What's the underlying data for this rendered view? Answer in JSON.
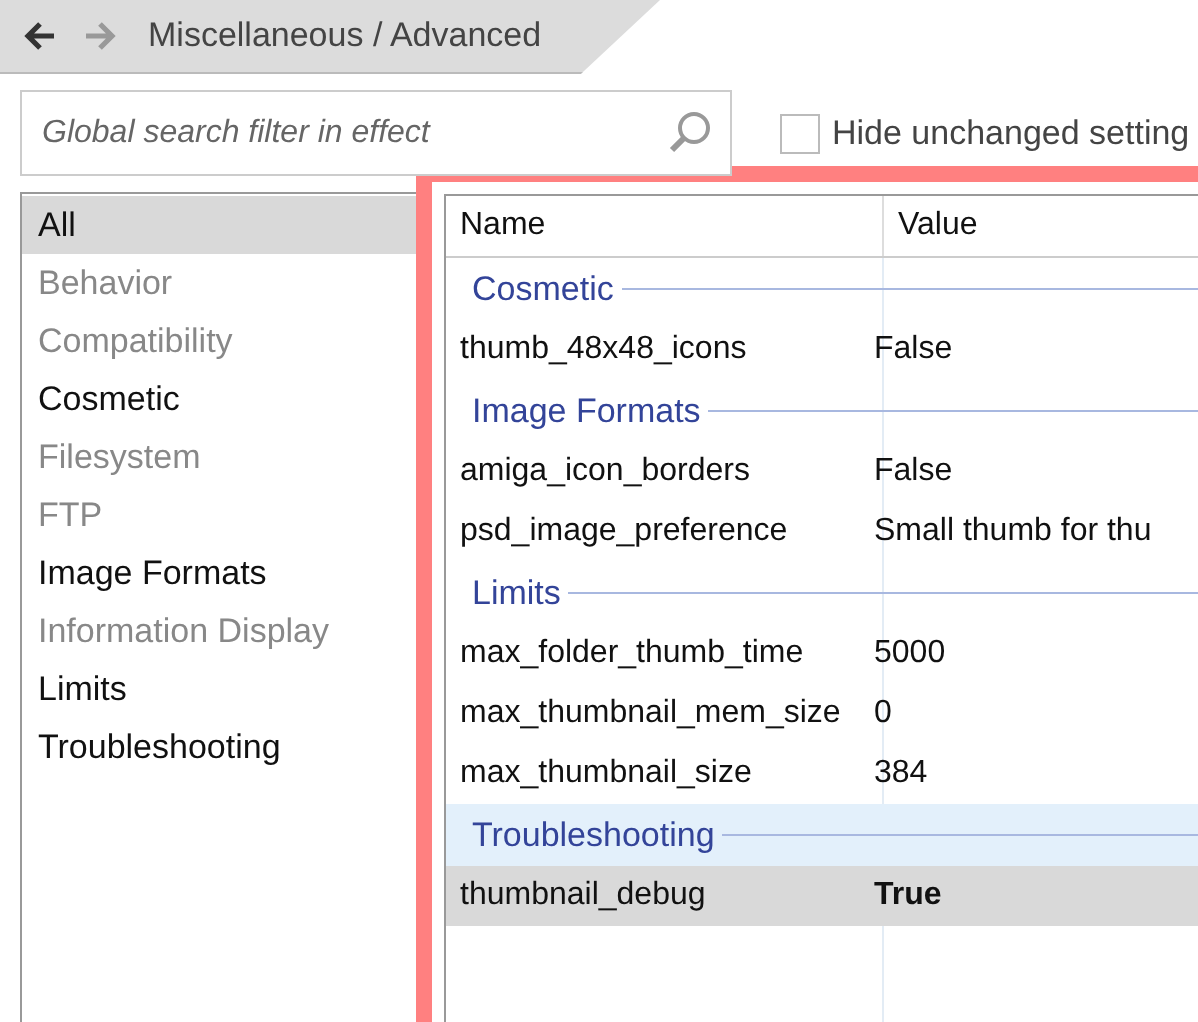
{
  "breadcrumb": {
    "back": {
      "disabled": false
    },
    "forward": {
      "disabled": true
    },
    "path": "Miscellaneous / Advanced"
  },
  "search": {
    "placeholder": "Global search filter in effect"
  },
  "hide_unchanged": {
    "label": "Hide unchanged setting",
    "checked": false
  },
  "categories": [
    {
      "label": "All",
      "selected": true,
      "disabled": false
    },
    {
      "label": "Behavior",
      "selected": false,
      "disabled": true
    },
    {
      "label": "Compatibility",
      "selected": false,
      "disabled": true
    },
    {
      "label": "Cosmetic",
      "selected": false,
      "disabled": false
    },
    {
      "label": "Filesystem",
      "selected": false,
      "disabled": true
    },
    {
      "label": "FTP",
      "selected": false,
      "disabled": true
    },
    {
      "label": "Image Formats",
      "selected": false,
      "disabled": false
    },
    {
      "label": "Information Display",
      "selected": false,
      "disabled": true
    },
    {
      "label": "Limits",
      "selected": false,
      "disabled": false
    },
    {
      "label": "Troubleshooting",
      "selected": false,
      "disabled": false
    }
  ],
  "table": {
    "columns": [
      "Name",
      "Value"
    ],
    "rows": [
      {
        "kind": "group",
        "label": "Cosmetic",
        "hovered": false
      },
      {
        "kind": "setting",
        "name": "thumb_48x48_icons",
        "value": "False",
        "modified": false,
        "selected": false
      },
      {
        "kind": "group",
        "label": "Image Formats",
        "hovered": false
      },
      {
        "kind": "setting",
        "name": "amiga_icon_borders",
        "value": "False",
        "modified": false,
        "selected": false
      },
      {
        "kind": "setting",
        "name": "psd_image_preference",
        "value": "Small thumb for thu",
        "modified": false,
        "selected": false
      },
      {
        "kind": "group",
        "label": "Limits",
        "hovered": false
      },
      {
        "kind": "setting",
        "name": "max_folder_thumb_time",
        "value": "5000",
        "modified": false,
        "selected": false
      },
      {
        "kind": "setting",
        "name": "max_thumbnail_mem_size",
        "value": "0",
        "modified": false,
        "selected": false
      },
      {
        "kind": "setting",
        "name": "max_thumbnail_size",
        "value": "384",
        "modified": false,
        "selected": false
      },
      {
        "kind": "group",
        "label": "Troubleshooting",
        "hovered": true
      },
      {
        "kind": "setting",
        "name": "thumbnail_debug",
        "value": "True",
        "modified": true,
        "selected": true
      }
    ]
  }
}
